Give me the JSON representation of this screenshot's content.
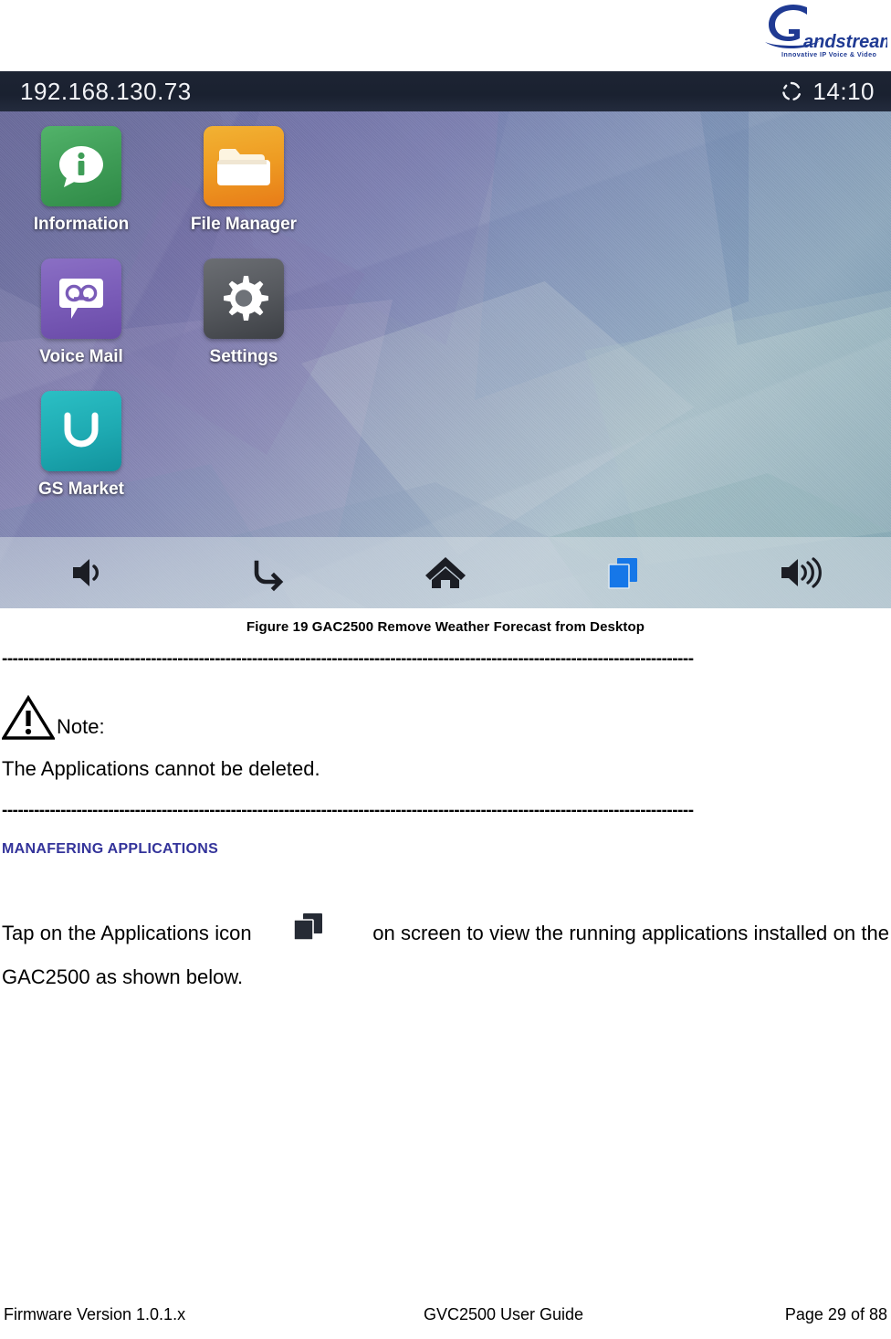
{
  "brand": {
    "name": "Grandstream",
    "tagline": "Innovative IP Voice & Video",
    "logo_color": "#1f3a93"
  },
  "device_screenshot": {
    "status_bar": {
      "ip_address": "192.168.130.73",
      "time": "14:10",
      "sync_icon": "rotating-sync-icon"
    },
    "apps": [
      {
        "label": "Information",
        "icon": "info-bubble-icon",
        "color": "#3f9d57",
        "key": "information"
      },
      {
        "label": "File Manager",
        "icon": "folder-icon",
        "color": "#ee9b22",
        "key": "filemanager"
      },
      {
        "label": "Voice Mail",
        "icon": "voicemail-tape-icon",
        "color": "#7a5cb8",
        "key": "voicemail"
      },
      {
        "label": "Settings",
        "icon": "gear-icon",
        "color": "#56595e",
        "key": "settings"
      },
      {
        "label": "GS Market",
        "icon": "shopping-bag-icon",
        "color": "#1eaab2",
        "key": "gsmarket"
      }
    ],
    "nav_buttons": [
      {
        "name": "volume-down-icon",
        "label": "Volume Down"
      },
      {
        "name": "back-icon",
        "label": "Back"
      },
      {
        "name": "home-icon",
        "label": "Home"
      },
      {
        "name": "recent-apps-icon",
        "label": "Applications",
        "color": "#1677e8"
      },
      {
        "name": "volume-up-icon",
        "label": "Volume Up"
      }
    ],
    "wallpaper": "low-poly-purple-teal"
  },
  "figure": {
    "caption": "Figure 19 GAC2500 Remove Weather Forecast from Desktop"
  },
  "separator": "----------------------------------------------------------------------------------------------------------------------------------",
  "note": {
    "icon": "warning-triangle-icon",
    "label": "Note:",
    "text": "The Applications cannot be deleted."
  },
  "section": {
    "heading": "MANAFERING APPLICATIONS",
    "heading_color": "#33339a"
  },
  "paragraph": {
    "before_icon": "Tap on the Applications icon",
    "inline_icon": "recent-apps-icon",
    "after_icon": "on screen to view the running applications installed on the GAC2500 as shown below."
  },
  "footer": {
    "left": "Firmware Version 1.0.1.x",
    "center": "GVC2500 User Guide",
    "right": "Page 29 of 88"
  }
}
